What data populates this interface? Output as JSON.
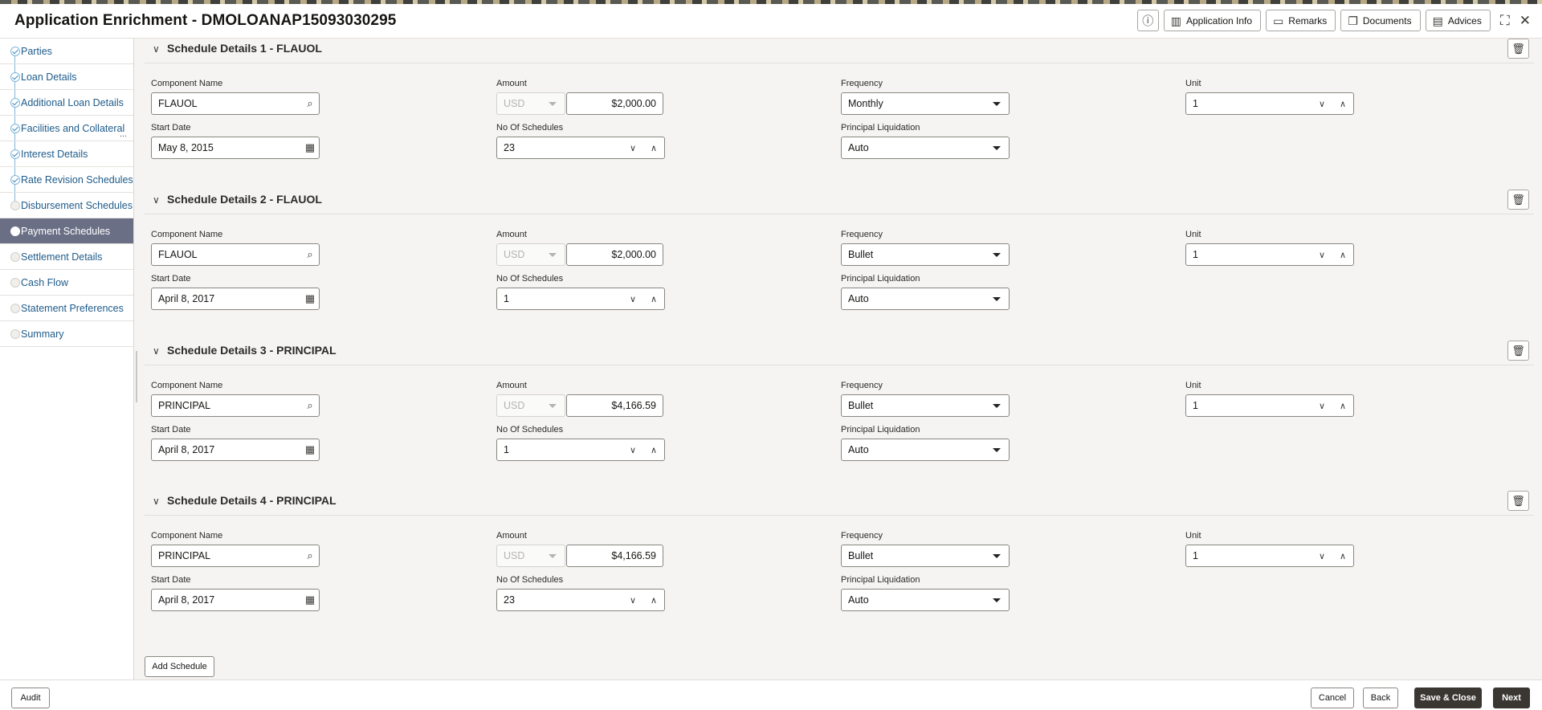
{
  "app": {
    "title": "Application Enrichment - DMOLOANAP15093030295"
  },
  "header": {
    "buttons": [
      {
        "label": "",
        "icon": "info-icon"
      },
      {
        "label": "Application Info",
        "icon": "book-icon"
      },
      {
        "label": "Remarks",
        "icon": "chat-icon"
      },
      {
        "label": "Documents",
        "icon": "documents-icon"
      },
      {
        "label": "Advices",
        "icon": "advices-icon"
      }
    ],
    "window_icons": [
      "collapse-icon",
      "close-icon"
    ]
  },
  "sidebar": {
    "items": [
      {
        "label": "Parties",
        "status": "done"
      },
      {
        "label": "Loan Details",
        "status": "done"
      },
      {
        "label": "Additional Loan Details",
        "status": "done"
      },
      {
        "label": "Facilities and Collateral",
        "status": "done",
        "overflow": "..."
      },
      {
        "label": "Interest Details",
        "status": "done"
      },
      {
        "label": "Rate Revision Schedules",
        "status": "done"
      },
      {
        "label": "Disbursement Schedules",
        "status": "pending"
      },
      {
        "label": "Payment Schedules",
        "status": "active"
      },
      {
        "label": "Settlement Details",
        "status": "pending"
      },
      {
        "label": "Cash Flow",
        "status": "pending"
      },
      {
        "label": "Statement Preferences",
        "status": "pending"
      },
      {
        "label": "Summary",
        "status": "pending"
      }
    ]
  },
  "labels": {
    "component_name": "Component Name",
    "amount": "Amount",
    "frequency": "Frequency",
    "unit": "Unit",
    "start_date": "Start Date",
    "no_of_schedules": "No Of Schedules",
    "principal_liquidation": "Principal Liquidation"
  },
  "sections": [
    {
      "title": "Schedule Details 1 - FLAUOL",
      "component": "FLAUOL",
      "currency": "USD",
      "amount": "$2,000.00",
      "frequency": "Monthly",
      "unit": "1",
      "start_date": "May 8, 2015",
      "no_of_schedules": "23",
      "principal_liquidation": "Auto"
    },
    {
      "title": "Schedule Details 2 - FLAUOL",
      "component": "FLAUOL",
      "currency": "USD",
      "amount": "$2,000.00",
      "frequency": "Bullet",
      "unit": "1",
      "start_date": "April 8, 2017",
      "no_of_schedules": "1",
      "principal_liquidation": "Auto"
    },
    {
      "title": "Schedule Details 3 - PRINCIPAL",
      "component": "PRINCIPAL",
      "currency": "USD",
      "amount": "$4,166.59",
      "frequency": "Bullet",
      "unit": "1",
      "start_date": "April 8, 2017",
      "no_of_schedules": "1",
      "principal_liquidation": "Auto"
    },
    {
      "title": "Schedule Details 4 - PRINCIPAL",
      "component": "PRINCIPAL",
      "currency": "USD",
      "amount": "$4,166.59",
      "frequency": "Bullet",
      "unit": "1",
      "start_date": "April 8, 2017",
      "no_of_schedules": "23",
      "principal_liquidation": "Auto"
    }
  ],
  "actions": {
    "add_schedule": "Add Schedule"
  },
  "footer": {
    "audit": "Audit",
    "cancel": "Cancel",
    "back": "Back",
    "save_close": "Save & Close",
    "next": "Next"
  }
}
